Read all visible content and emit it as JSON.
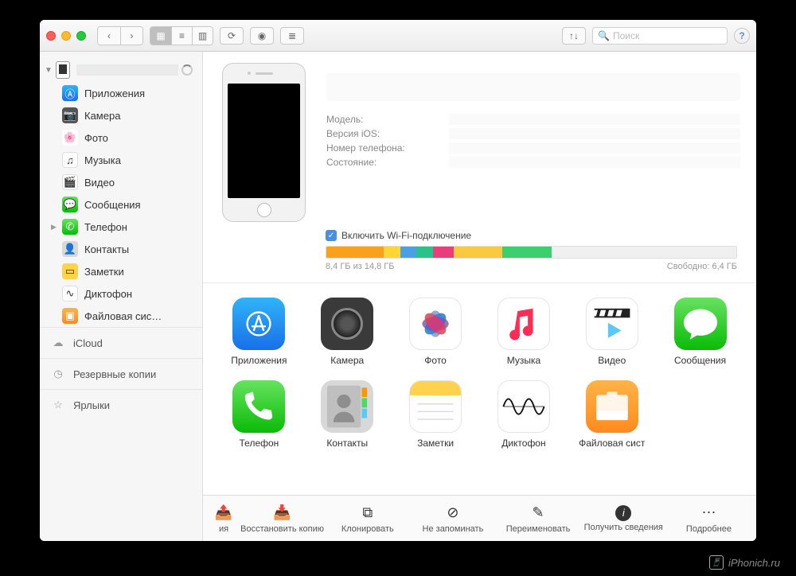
{
  "toolbar": {
    "search_placeholder": "Поиск"
  },
  "sidebar": {
    "device_name": "",
    "items": [
      {
        "label": "Приложения"
      },
      {
        "label": "Камера"
      },
      {
        "label": "Фото"
      },
      {
        "label": "Музыка"
      },
      {
        "label": "Видео"
      },
      {
        "label": "Сообщения"
      },
      {
        "label": "Телефон"
      },
      {
        "label": "Контакты"
      },
      {
        "label": "Заметки"
      },
      {
        "label": "Диктофон"
      },
      {
        "label": "Файловая сис…"
      }
    ],
    "sections": {
      "icloud": "iCloud",
      "backups": "Резервные копии",
      "shortcuts": "Ярлыки"
    }
  },
  "info": {
    "model_label": "Модель:",
    "ios_label": "Версия iOS:",
    "phone_label": "Номер телефона:",
    "state_label": "Состояние:"
  },
  "storage": {
    "wifi_label": "Включить Wi-Fi-подключение",
    "used_label": "8,4 ГБ из 14,8 ГБ",
    "free_label": "Свободно: 6,4 ГБ",
    "segments": [
      {
        "color": "#f9a11b",
        "pct": 14
      },
      {
        "color": "#ffd633",
        "pct": 4
      },
      {
        "color": "#4aa0e2",
        "pct": 4
      },
      {
        "color": "#29c28b",
        "pct": 4
      },
      {
        "color": "#e83f7a",
        "pct": 5
      },
      {
        "color": "#f9ca3e",
        "pct": 12
      },
      {
        "color": "#3bcf6e",
        "pct": 12
      },
      {
        "color": "#f0f0f0",
        "pct": 45
      }
    ]
  },
  "apps": [
    {
      "label": "Приложения"
    },
    {
      "label": "Камера"
    },
    {
      "label": "Фото"
    },
    {
      "label": "Музыка"
    },
    {
      "label": "Видео"
    },
    {
      "label": "Сообщения"
    },
    {
      "label": "Телефон"
    },
    {
      "label": "Контакты"
    },
    {
      "label": "Заметки"
    },
    {
      "label": "Диктофон"
    },
    {
      "label": "Файловая сист"
    }
  ],
  "bottom": [
    {
      "label": "ия"
    },
    {
      "label": "Восстановить копию"
    },
    {
      "label": "Клонировать"
    },
    {
      "label": "Не запоминать"
    },
    {
      "label": "Переименовать"
    },
    {
      "label": "Получить сведения"
    },
    {
      "label": "Подробнее"
    }
  ],
  "watermark": "iPhonich.ru"
}
